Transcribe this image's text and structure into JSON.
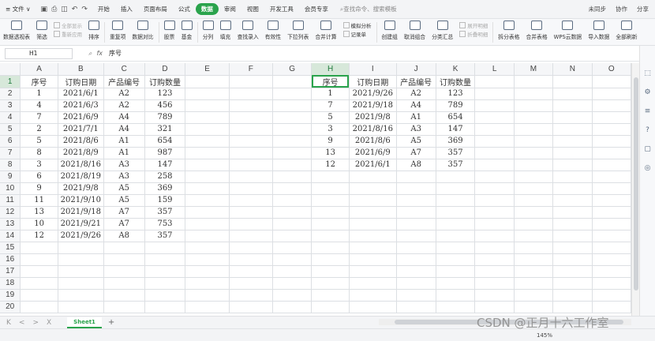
{
  "menubar": {
    "file_label": "≡ 文件 ∨",
    "quick_icons": [
      "save-icon",
      "print-icon",
      "preview-icon",
      "undo-icon",
      "redo-icon"
    ],
    "tabs": [
      "开始",
      "插入",
      "页面布局",
      "公式",
      "数据",
      "审阅",
      "视图",
      "开发工具",
      "会员专享"
    ],
    "active_tab": "数据",
    "search_placeholder": "查找命令、搜索模板",
    "sync": "未同步",
    "collab": "协作",
    "share": "分享"
  },
  "ribbon": {
    "buttons": [
      "数据透视表",
      "筛选",
      "排序",
      "重复项",
      "数据对比",
      "股票",
      "基金",
      "分列",
      "填充",
      "查找录入",
      "有效性",
      "下拉列表",
      "合并计算",
      "记录单",
      "创建组",
      "取消组合",
      "分类汇总",
      "拆分表格",
      "合并表格",
      "WPS云数据",
      "导入数据",
      "全部刷新"
    ],
    "filter_sub": [
      "全部显示",
      "重新应用"
    ],
    "whatif": "模拟分析",
    "outline_sub": [
      "展开明细",
      "折叠明细"
    ]
  },
  "formula_bar": {
    "name_box": "H1",
    "fx_label": "fx",
    "content": "序号"
  },
  "grid": {
    "columns": [
      "A",
      "B",
      "C",
      "D",
      "E",
      "F",
      "G",
      "H",
      "I",
      "J",
      "K",
      "L",
      "M",
      "N",
      "O"
    ],
    "row_numbers": [
      "1",
      "2",
      "3",
      "4",
      "5",
      "6",
      "7",
      "8",
      "9",
      "10",
      "11",
      "12",
      "13",
      "14",
      "15",
      "16",
      "17",
      "18",
      "19",
      "20"
    ],
    "selected_column": "H",
    "selected_row": "1",
    "left_table": {
      "headers": [
        "序号",
        "订购日期",
        "产品编号",
        "订购数量"
      ],
      "rows": [
        [
          "1",
          "2021/6/1",
          "A2",
          "123"
        ],
        [
          "4",
          "2021/6/3",
          "A2",
          "456"
        ],
        [
          "7",
          "2021/6/9",
          "A4",
          "789"
        ],
        [
          "2",
          "2021/7/1",
          "A4",
          "321"
        ],
        [
          "5",
          "2021/8/6",
          "A1",
          "654"
        ],
        [
          "8",
          "2021/8/9",
          "A1",
          "987"
        ],
        [
          "3",
          "2021/8/16",
          "A3",
          "147"
        ],
        [
          "6",
          "2021/8/19",
          "A3",
          "258"
        ],
        [
          "9",
          "2021/9/8",
          "A5",
          "369"
        ],
        [
          "11",
          "2021/9/10",
          "A5",
          "159"
        ],
        [
          "13",
          "2021/9/18",
          "A7",
          "357"
        ],
        [
          "10",
          "2021/9/21",
          "A7",
          "753"
        ],
        [
          "12",
          "2021/9/26",
          "A8",
          "357"
        ]
      ]
    },
    "right_table": {
      "headers": [
        "序号",
        "订购日期",
        "产品编号",
        "订购数量"
      ],
      "rows": [
        [
          "1",
          "2021/9/26",
          "A2",
          "123"
        ],
        [
          "7",
          "2021/9/18",
          "A4",
          "789"
        ],
        [
          "5",
          "2021/9/8",
          "A1",
          "654"
        ],
        [
          "3",
          "2021/8/16",
          "A3",
          "147"
        ],
        [
          "9",
          "2021/8/6",
          "A5",
          "369"
        ],
        [
          "13",
          "2021/6/9",
          "A7",
          "357"
        ],
        [
          "12",
          "2021/6/1",
          "A8",
          "357"
        ]
      ]
    }
  },
  "sheets": {
    "nav": [
      "K",
      "<",
      ">",
      "X"
    ],
    "active": "Sheet1",
    "add": "+"
  },
  "status": {
    "zoom": "145%"
  },
  "watermark": "CSDN @正月十六工作室"
}
